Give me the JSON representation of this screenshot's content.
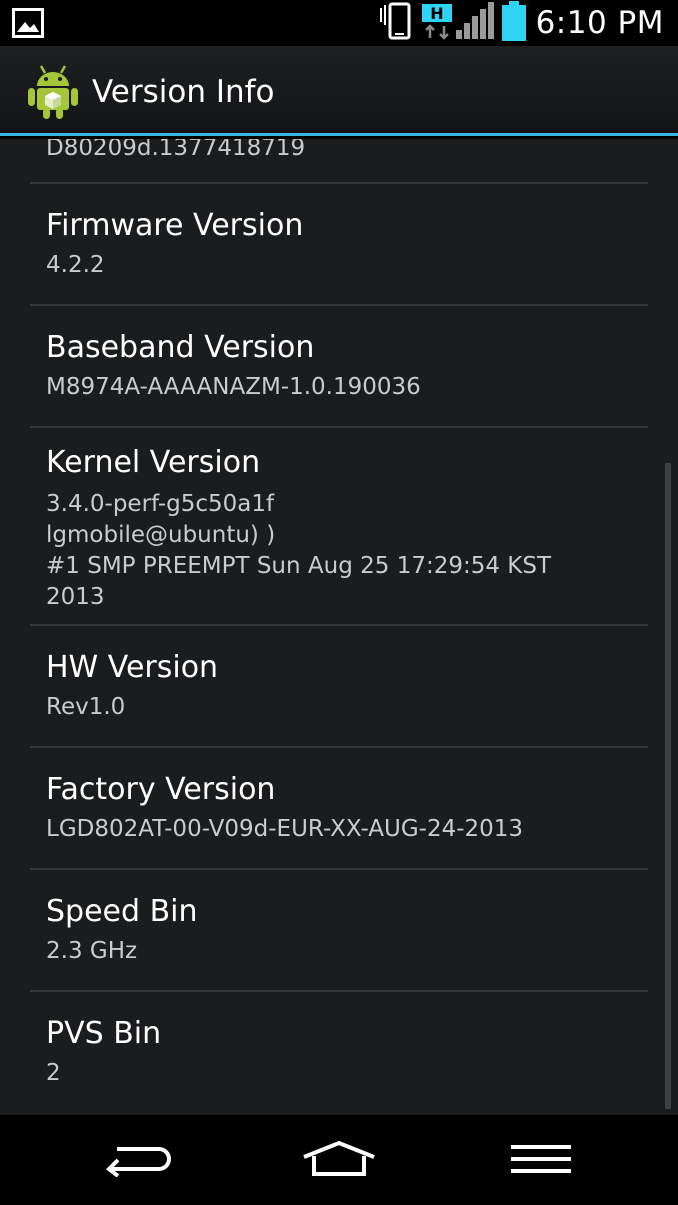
{
  "status_bar": {
    "time": "6:10 PM",
    "network_badge": "H",
    "notification_icon": "image-icon",
    "battery_color": "#2fd3f3",
    "signal_color": "#9a9a9a"
  },
  "action_bar": {
    "title": "Version Info",
    "icon": "android-icon",
    "accent_color": "#38b4dd"
  },
  "list": {
    "top_partial_value": "D80209d.1377418719",
    "items": [
      {
        "label": "Firmware Version",
        "value": "4.2.2"
      },
      {
        "label": "Baseband Version",
        "value": "M8974A-AAAANAZM-1.0.190036"
      },
      {
        "label": "Kernel Version",
        "value": "3.4.0-perf-g5c50a1f\nlgmobile@ubuntu) )\n#1 SMP PREEMPT Sun Aug 25 17:29:54 KST\n2013"
      },
      {
        "label": "HW Version",
        "value": "Rev1.0"
      },
      {
        "label": "Factory Version",
        "value": "LGD802AT-00-V09d-EUR-XX-AUG-24-2013"
      },
      {
        "label": "Speed Bin",
        "value": "2.3 GHz"
      },
      {
        "label": "PVS Bin",
        "value": "2"
      }
    ]
  },
  "nav_bar": {
    "back_icon": "back-arrow-icon",
    "home_icon": "home-icon",
    "menu_icon": "menu-icon"
  }
}
